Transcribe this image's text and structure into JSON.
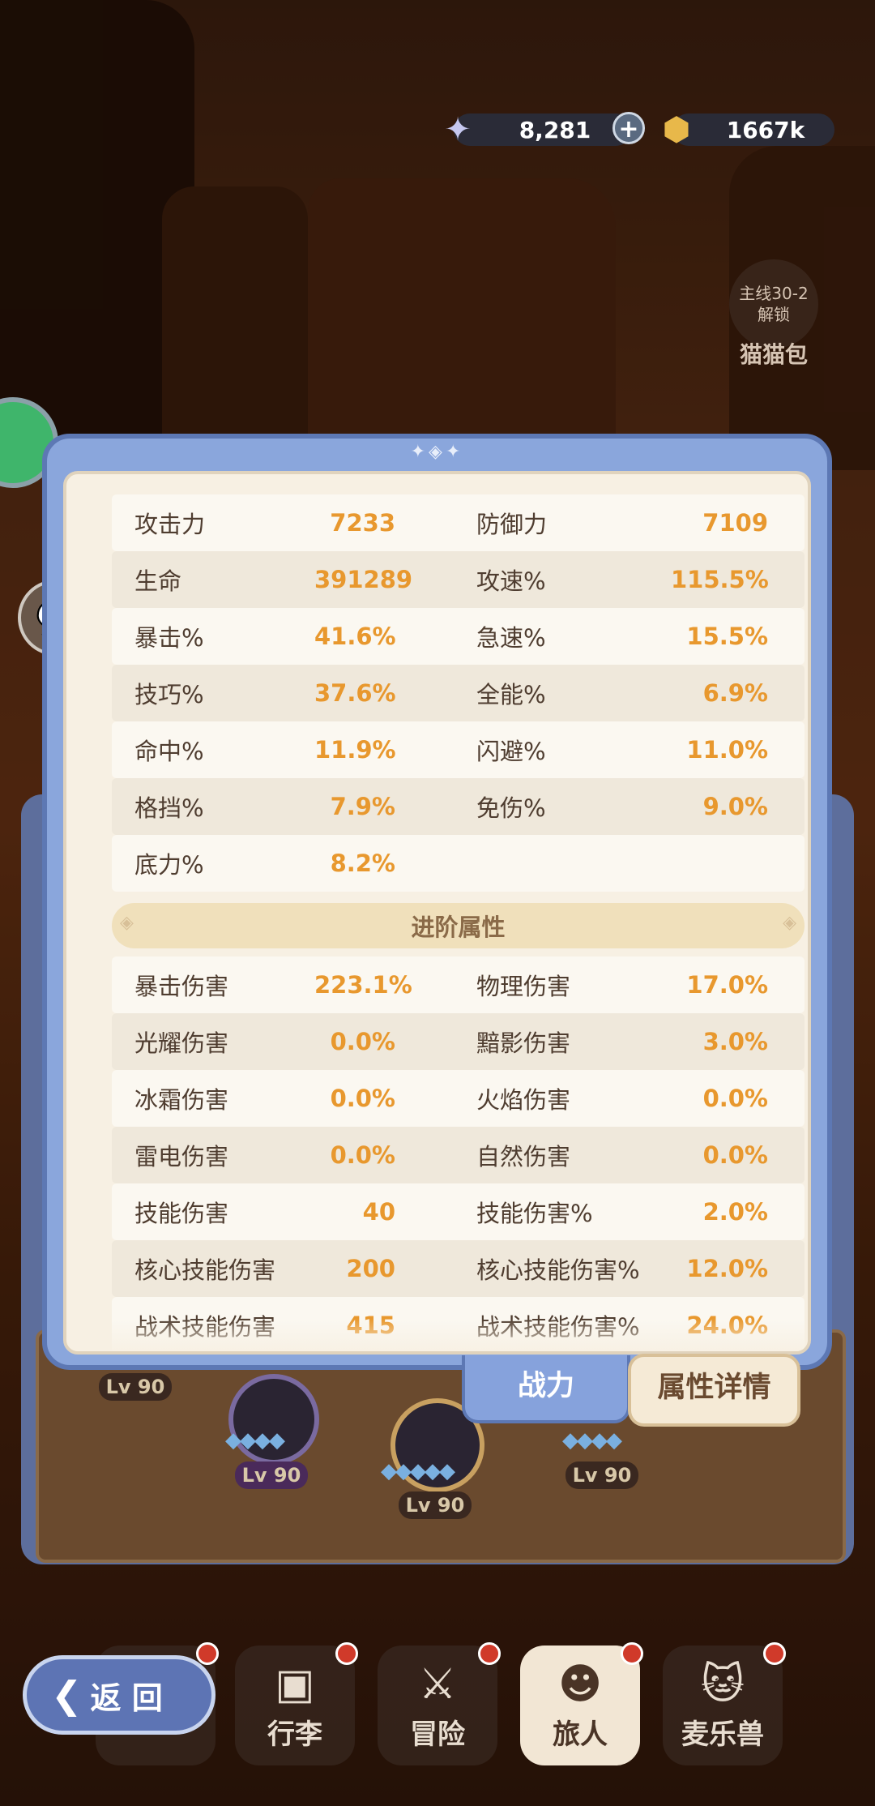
{
  "currency": {
    "gems": "8,281",
    "gold": "1667k"
  },
  "side": {
    "locked_line1": "主线30-2",
    "locked_line2": "解锁",
    "locked_title": "猫猫包"
  },
  "stats": [
    {
      "l1": "攻击力",
      "v1": "7233",
      "l2": "防御力",
      "v2": "7109"
    },
    {
      "l1": "生命",
      "v1": "391289",
      "l2": "攻速%",
      "v2": "115.5%"
    },
    {
      "l1": "暴击%",
      "v1": "41.6%",
      "l2": "急速%",
      "v2": "15.5%"
    },
    {
      "l1": "技巧%",
      "v1": "37.6%",
      "l2": "全能%",
      "v2": "6.9%"
    },
    {
      "l1": "命中%",
      "v1": "11.9%",
      "l2": "闪避%",
      "v2": "11.0%"
    },
    {
      "l1": "格挡%",
      "v1": "7.9%",
      "l2": "免伤%",
      "v2": "9.0%"
    },
    {
      "l1": "底力%",
      "v1": "8.2%",
      "l2": "",
      "v2": ""
    }
  ],
  "advanced_title": "进阶属性",
  "advanced": [
    {
      "l1": "暴击伤害",
      "v1": "223.1%",
      "l2": "物理伤害",
      "v2": "17.0%"
    },
    {
      "l1": "光耀伤害",
      "v1": "0.0%",
      "l2": "黯影伤害",
      "v2": "3.0%"
    },
    {
      "l1": "冰霜伤害",
      "v1": "0.0%",
      "l2": "火焰伤害",
      "v2": "0.0%"
    },
    {
      "l1": "雷电伤害",
      "v1": "0.0%",
      "l2": "自然伤害",
      "v2": "0.0%"
    },
    {
      "l1": "技能伤害",
      "v1": "40",
      "l2": "技能伤害%",
      "v2": "2.0%"
    },
    {
      "l1": "核心技能伤害",
      "v1": "200",
      "l2": "核心技能伤害%",
      "v2": "12.0%"
    },
    {
      "l1": "战术技能伤害",
      "v1": "415",
      "l2": "战术技能伤害%",
      "v2": "24.0%"
    }
  ],
  "tabs": {
    "power": "战力",
    "detail": "属性详情"
  },
  "heroes": {
    "lv_left": "Lv 90",
    "lv_1": "Lv 90",
    "lv_2": "Lv 90",
    "lv_3": "Lv 90"
  },
  "nav": {
    "back": "返 回",
    "items": [
      {
        "label": "",
        "icon": "crown-icon"
      },
      {
        "label": "行李",
        "icon": "bag-icon"
      },
      {
        "label": "冒险",
        "icon": "swords-icon"
      },
      {
        "label": "旅人",
        "icon": "traveler-icon"
      },
      {
        "label": "麦乐兽",
        "icon": "pet-icon"
      }
    ]
  },
  "colors": {
    "accent_blue": "#86a2dc",
    "value_orange": "#e8982e",
    "panel_bg": "#f7f0e3"
  }
}
